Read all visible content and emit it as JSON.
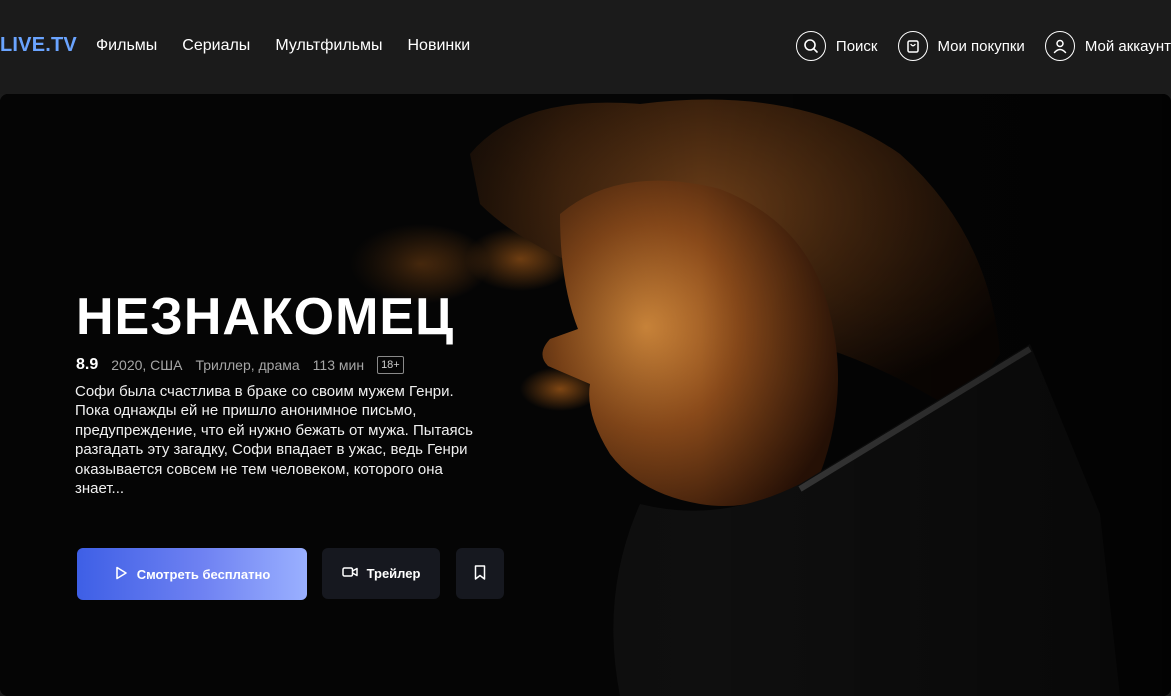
{
  "header": {
    "logo": "LIVE.TV",
    "nav": [
      "Фильмы",
      "Сериалы",
      "Мультфильмы",
      "Новинки"
    ],
    "search_label": "Поиск",
    "purchases_label": "Мои покупки",
    "account_label": "Мой аккаунт"
  },
  "hero": {
    "title": "НЕЗНАКОМЕЦ",
    "rating": "8.9",
    "year_country": "2020, США",
    "genres": "Триллер, драма",
    "duration": "113 мин",
    "age_rating": "18+",
    "description": "Софи была счастлива в браке со своим мужем Генри. Пока однажды ей не пришло анонимное письмо, предупреждение, что ей нужно бежать от мужа. Пытаясь разгадать эту загадку, Софи впадает в ужас, ведь Генри оказывается совсем не тем человеком, которого она знает...",
    "watch_button": "Смотреть бесплатно",
    "trailer_button": "Трейлер"
  },
  "icons": {
    "search": "search-icon",
    "purchases": "bag-icon",
    "account": "user-icon",
    "watch": "play-icon",
    "trailer": "video-camera-icon",
    "bookmark": "bookmark-icon"
  },
  "colors": {
    "logo": "#6aa4ff",
    "watch_gradient_start": "#3e5fe6",
    "watch_gradient_end": "#9ab0ff",
    "secondary_button": "#16181f"
  }
}
